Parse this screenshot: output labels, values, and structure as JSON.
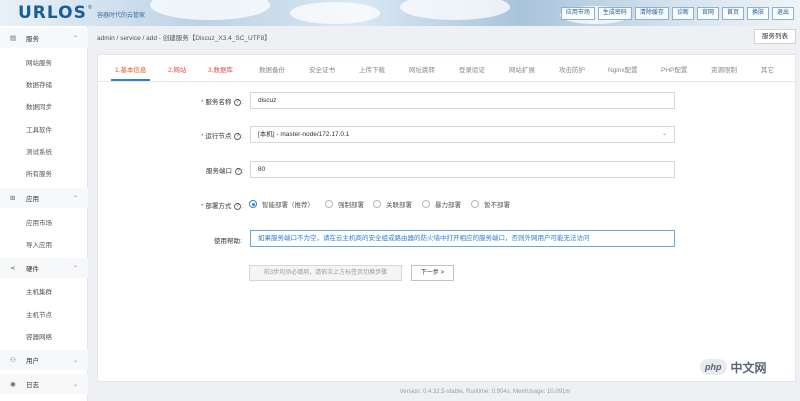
{
  "header": {
    "logo": "URLOS",
    "logo_mark": "®",
    "slogan": "容器时代的云管家",
    "nav": [
      "应用市场",
      "生成密码",
      "清除缓存",
      "诊断",
      "官网",
      "首页",
      "换肤",
      "退出"
    ]
  },
  "sidebar": {
    "groups": [
      {
        "label": "服务",
        "icon": "server-icon",
        "items": [
          "网站服务",
          "数据存储",
          "数据同步",
          "工具软件",
          "测试系统",
          "所有服务"
        ]
      },
      {
        "label": "应用",
        "icon": "grid-icon",
        "items": [
          "应用市场",
          "导入应用"
        ]
      },
      {
        "label": "硬件",
        "icon": "share-icon",
        "items": [
          "主机集群",
          "主机节点",
          "容器网络"
        ]
      },
      {
        "label": "用户",
        "icon": "user-icon",
        "items": []
      },
      {
        "label": "日志",
        "icon": "eye-icon",
        "items": []
      }
    ]
  },
  "breadcrumb": "admin  /  service  /  add  -  创建服务【Discuz_X3.4_SC_UTF8】",
  "service_list_button": "服务列表",
  "tabs": [
    "1.基本信息",
    "2.网站",
    "3.数据库",
    "数据备份",
    "安全证书",
    "上传下载",
    "网址跳转",
    "登录验证",
    "网站扩展",
    "攻击防护",
    "Nginx配置",
    "PHP配置",
    "资源限制",
    "其它"
  ],
  "form": {
    "service_name": {
      "label": "服务名称",
      "value": "discuz"
    },
    "run_node": {
      "label": "运行节点",
      "value": "[本机] - master-node/172.17.0.1"
    },
    "service_port": {
      "label": "服务端口",
      "value": "80"
    },
    "deploy_mode": {
      "label": "部署方式",
      "options": [
        "智能部署（推荐）",
        "强制部署",
        "关联部署",
        "暴力部署",
        "暂不部署"
      ],
      "selected": 0
    },
    "help": {
      "label": "使用帮助:",
      "text": "如果服务端口不为空，请在云主机商的安全组或路由器的防火墙中打开相应的服务端口，否则外网用户可能无法访问"
    }
  },
  "buttons": {
    "disabled_hint": "前3步均须必填项，请依次上方标签页切换步骤",
    "next": "下一步"
  },
  "footer": "Version: 0.4.32.5-stable,   Runtime: 0.904s,   MemUsage: 10.091m",
  "watermark": {
    "badge": "php",
    "text": "中文网"
  },
  "colors": {
    "accent": "#2f7ed8",
    "active_tab": "#e05a1c",
    "required": "#d9534f"
  }
}
